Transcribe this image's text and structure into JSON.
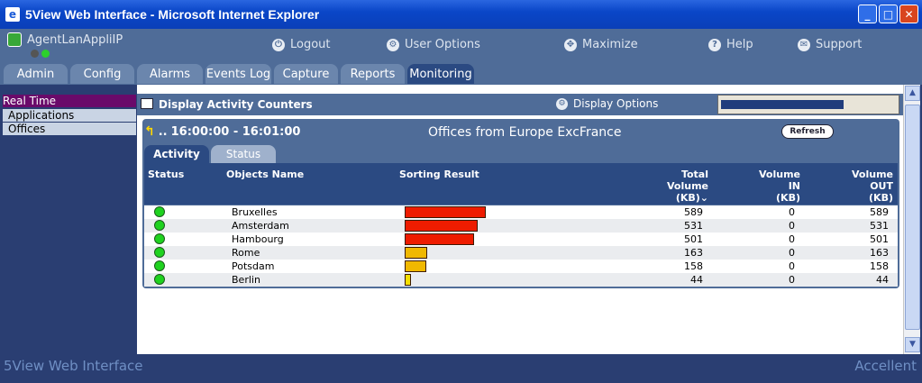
{
  "window": {
    "title": "5View Web Interface - Microsoft Internet Explorer"
  },
  "header": {
    "agent": "AgentLanAppliIP",
    "nav": [
      {
        "label": "Logout",
        "icon": "power-icon"
      },
      {
        "label": "User Options",
        "icon": "options-icon"
      },
      {
        "label": "Maximize",
        "icon": "maximize-icon"
      },
      {
        "label": "Help",
        "icon": "help-icon"
      },
      {
        "label": "Support",
        "icon": "mail-icon"
      }
    ]
  },
  "tabs": [
    "Admin",
    "Config",
    "Alarms",
    "Events Log",
    "Capture",
    "Reports",
    "Monitoring"
  ],
  "active_tab": "Monitoring",
  "sidebar": {
    "items": [
      "Real Time",
      "Applications",
      "Offices"
    ]
  },
  "panel": {
    "title": "Display Activity Counters",
    "display_options": "Display Options",
    "progress": 0.7,
    "time_range": "16:00:00 - 16:01:00",
    "nav_dots": "..",
    "view_title": "Offices from Europe ExcFrance",
    "refresh_label": "Refresh",
    "subtabs": [
      "Activity",
      "Status"
    ]
  },
  "table": {
    "columns": {
      "status": "Status",
      "name": "Objects Name",
      "sorting": "Sorting Result",
      "total_1": "Total",
      "total_2": "Volume",
      "total_3": "(KB)",
      "in_1": "Volume",
      "in_2": "IN",
      "in_3": "(KB)",
      "out_1": "Volume",
      "out_2": "OUT",
      "out_3": "(KB)"
    },
    "rows": [
      {
        "name": "Bruxelles",
        "total": "589",
        "in": "0",
        "out": "589"
      },
      {
        "name": "Amsterdam",
        "total": "531",
        "in": "0",
        "out": "531"
      },
      {
        "name": "Hambourg",
        "total": "501",
        "in": "0",
        "out": "501"
      },
      {
        "name": "Rome",
        "total": "163",
        "in": "0",
        "out": "163"
      },
      {
        "name": "Potsdam",
        "total": "158",
        "in": "0",
        "out": "158"
      },
      {
        "name": "Berlin",
        "total": "44",
        "in": "0",
        "out": "44"
      }
    ],
    "max_total": 589,
    "colors": {
      "high": "#ee1c00",
      "mid": "#f0b800",
      "low": "#f5e000"
    }
  },
  "footer": {
    "left": "5View Web Interface",
    "right": "Accellent"
  }
}
